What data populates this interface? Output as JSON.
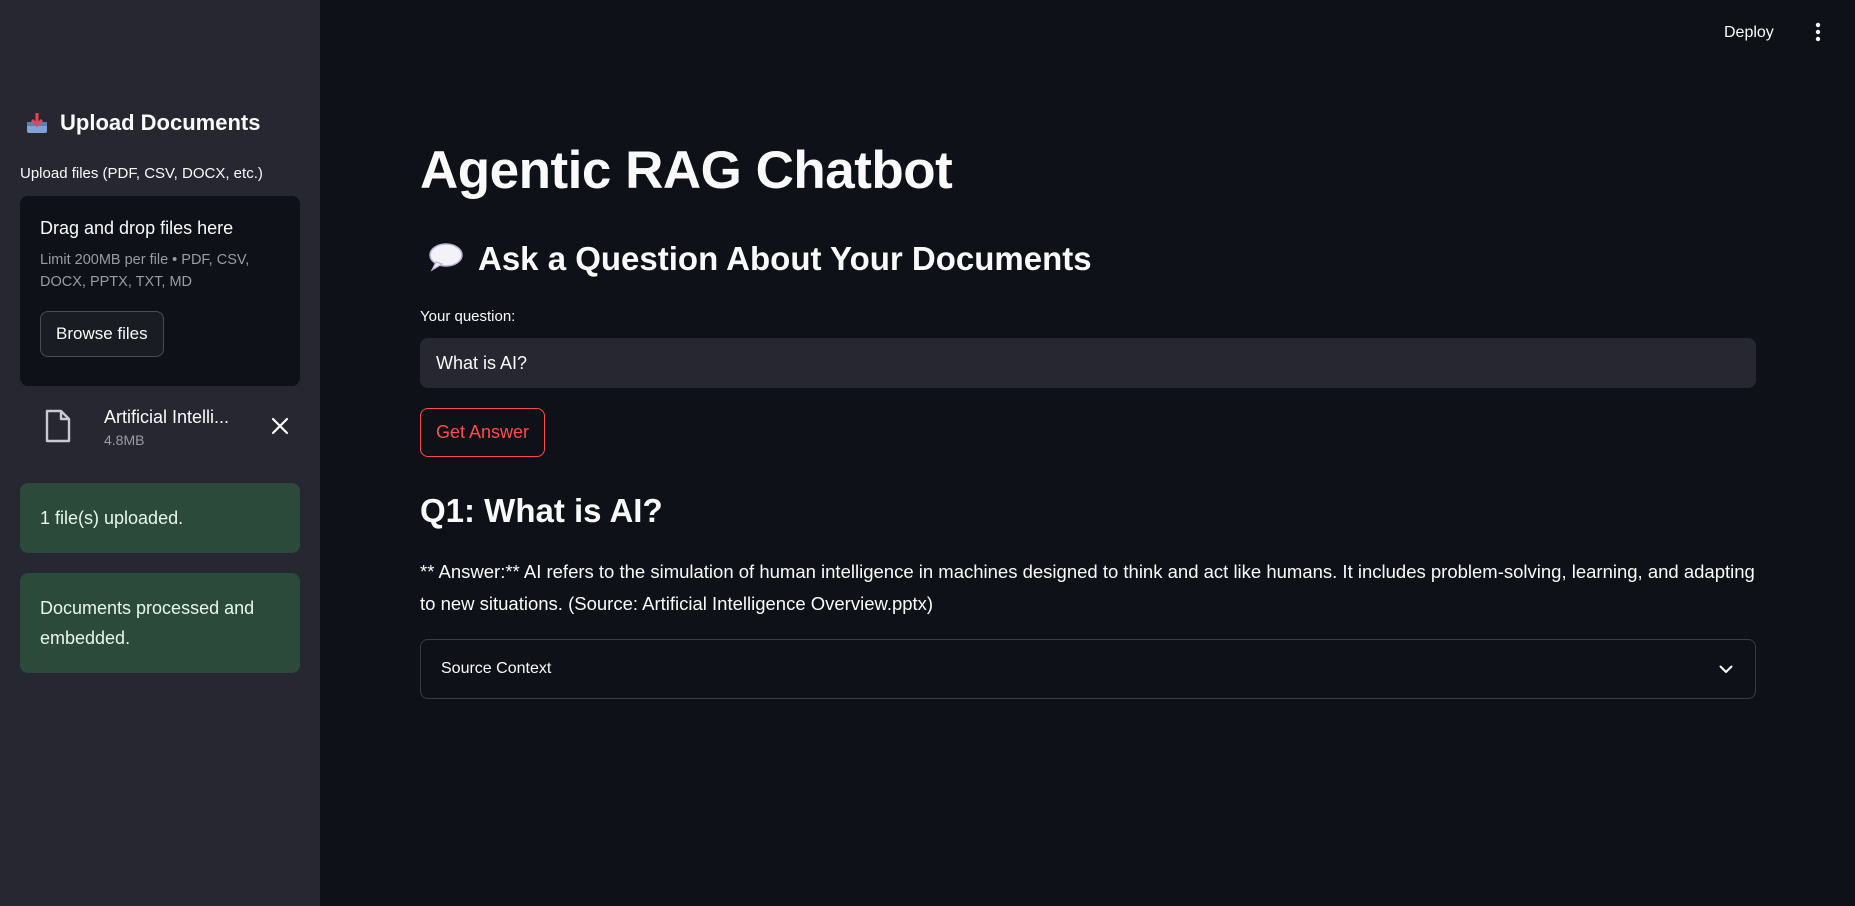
{
  "sidebar": {
    "title": "Upload Documents",
    "title_icon": "inbox-tray-icon",
    "uploader_label": "Upload files (PDF, CSV, DOCX, etc.)",
    "dropzone_title": "Drag and drop files here",
    "dropzone_limit": "Limit 200MB per file • PDF, CSV, DOCX, PPTX, TXT, MD",
    "browse_label": "Browse files",
    "file": {
      "name": "Artificial Intelli...",
      "size": "4.8MB",
      "icon": "file-icon"
    },
    "alerts": [
      "1 file(s) uploaded.",
      "Documents processed and embedded."
    ]
  },
  "header": {
    "deploy_label": "Deploy",
    "menu_icon": "more-vertical-icon"
  },
  "main": {
    "title": "Agentic RAG Chatbot",
    "subheader": "Ask a Question About Your Documents",
    "subheader_icon": "speech-balloon-icon",
    "input_label": "Your question:",
    "input_value": "What is AI?",
    "submit_label": "Get Answer",
    "question_title": "Q1: What is AI?",
    "answer": "** Answer:** AI refers to the simulation of human intelligence in machines designed to think and act like humans. It includes problem-solving, learning, and adapting to new situations. (Source: Artificial Intelligence Overview.pptx)",
    "expander_label": "Source Context"
  },
  "colors": {
    "background": "#0e1117",
    "sidebar": "#262730",
    "accent": "#ff4b4b",
    "success_bg": "#2b4a3a"
  }
}
